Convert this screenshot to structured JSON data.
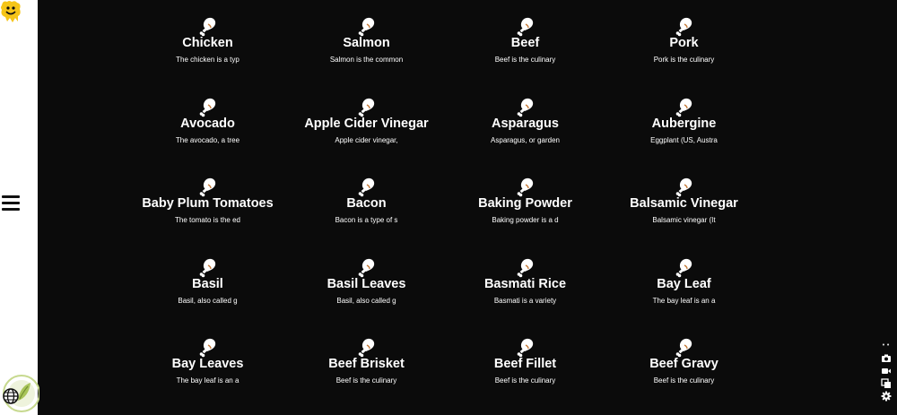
{
  "sidebar": {
    "logo_icon": "smiley-monster-logo",
    "menu_icon": "hamburger-menu-icon",
    "language_icon": "globe-icon",
    "badge_icon": "leaf-badge-icon"
  },
  "items": [
    {
      "title": "Chicken",
      "desc": "The chicken is a typ"
    },
    {
      "title": "Salmon",
      "desc": "Salmon is the common"
    },
    {
      "title": "Beef",
      "desc": "Beef is the culinary"
    },
    {
      "title": "Pork",
      "desc": "Pork is the culinary"
    },
    {
      "title": "Avocado",
      "desc": "The avocado, a tree"
    },
    {
      "title": "Apple Cider Vinegar",
      "desc": "Apple cider vinegar,"
    },
    {
      "title": "Asparagus",
      "desc": "Asparagus, or garden"
    },
    {
      "title": "Aubergine",
      "desc": "Eggplant (US, Austra"
    },
    {
      "title": "Baby Plum Tomatoes",
      "desc": "The tomato is the ed"
    },
    {
      "title": "Bacon",
      "desc": "Bacon is a type of s"
    },
    {
      "title": "Baking Powder",
      "desc": "Baking powder is a d"
    },
    {
      "title": "Balsamic Vinegar",
      "desc": "Balsamic vinegar (It"
    },
    {
      "title": "Basil",
      "desc": "Basil, also called g"
    },
    {
      "title": "Basil Leaves",
      "desc": "Basil, also called g"
    },
    {
      "title": "Basmati Rice",
      "desc": "Basmati is a variety"
    },
    {
      "title": "Bay Leaf",
      "desc": "The bay leaf is an a"
    },
    {
      "title": "Bay Leaves",
      "desc": "The bay leaf is an a"
    },
    {
      "title": "Beef Brisket",
      "desc": "Beef is the culinary"
    },
    {
      "title": "Beef Fillet",
      "desc": "Beef is the culinary"
    },
    {
      "title": "Beef Gravy",
      "desc": "Beef is the culinary"
    }
  ],
  "item_icon": "drumstick-icon",
  "toolbar": {
    "tools": [
      "camera-icon",
      "video-camera-icon",
      "copy-icon",
      "settings-gear-icon"
    ]
  },
  "colors": {
    "background": "#0b0b0b",
    "sidebar": "#ffffff",
    "text": "#ffffff",
    "logo": "#f5c518"
  }
}
